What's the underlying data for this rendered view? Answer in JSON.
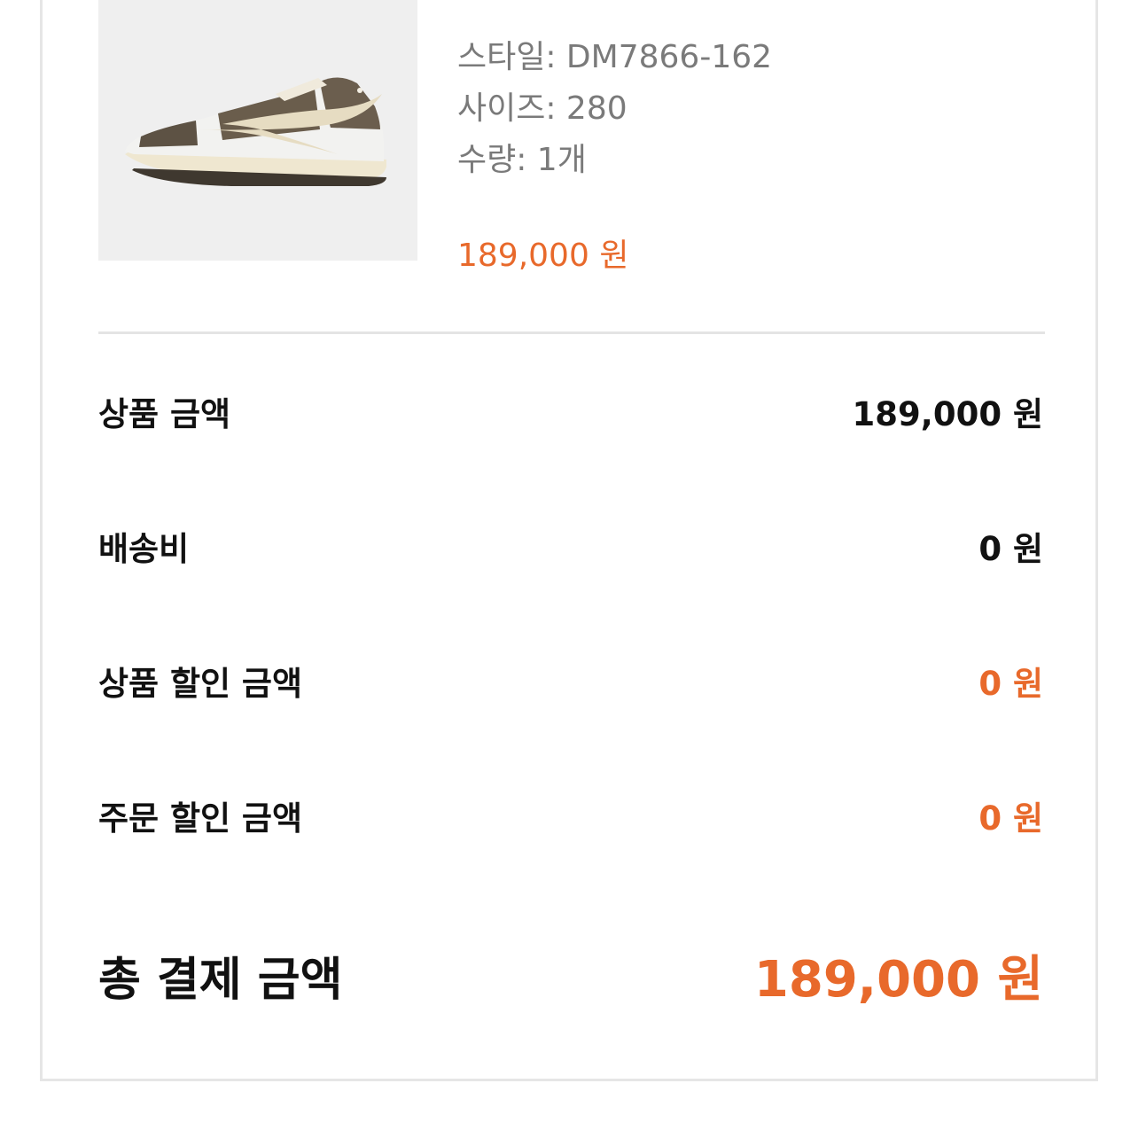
{
  "colors": {
    "accent": "#e8692b",
    "text_primary": "#111111",
    "text_secondary": "#7a7a7a",
    "border": "#e6e6e6"
  },
  "product": {
    "image_icon": "sneaker-image",
    "style": "스타일: DM7866-162",
    "size": "사이즈: 280",
    "quantity": "수량: 1개",
    "price": "189,000 원"
  },
  "summary": {
    "product_amount": {
      "label": "상품 금액",
      "value": "189,000 원"
    },
    "shipping": {
      "label": "배송비",
      "value": "0 원"
    },
    "product_discount": {
      "label": "상품 할인 금액",
      "value": "0 원"
    },
    "order_discount": {
      "label": "주문 할인 금액",
      "value": "0 원"
    },
    "total": {
      "label": "총 결제 금액",
      "value": "189,000 원"
    }
  }
}
